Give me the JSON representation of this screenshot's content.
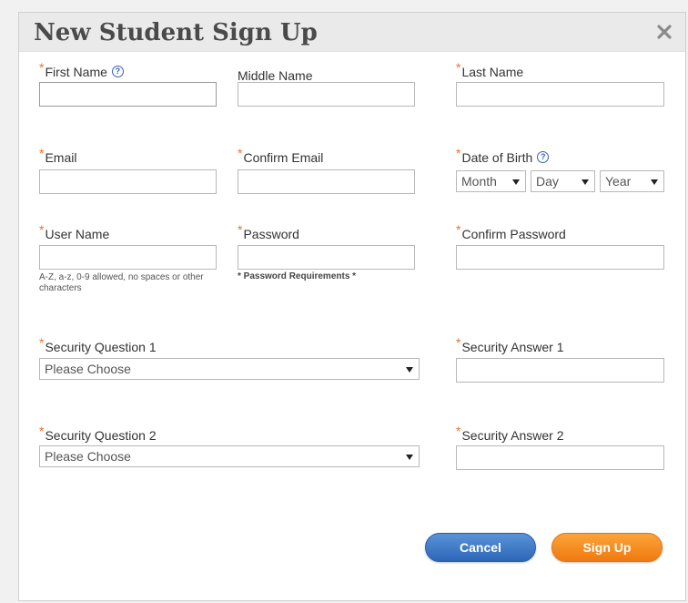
{
  "dialog": {
    "title": "New Student Sign Up",
    "close_icon": "close-icon"
  },
  "fields": {
    "first_name": {
      "label": "First Name",
      "required": true,
      "has_help": true,
      "value": ""
    },
    "middle_name": {
      "label": "Middle Name",
      "required": false,
      "value": ""
    },
    "last_name": {
      "label": "Last Name",
      "required": true,
      "value": ""
    },
    "email": {
      "label": "Email",
      "required": true,
      "value": ""
    },
    "confirm_email": {
      "label": "Confirm Email",
      "required": true,
      "value": ""
    },
    "date_of_birth": {
      "label": "Date of Birth",
      "required": true,
      "has_help": true,
      "month": "Month",
      "day": "Day",
      "year": "Year"
    },
    "user_name": {
      "label": "User Name",
      "required": true,
      "value": "",
      "hint": "A-Z, a-z, 0-9 allowed, no spaces or other characters"
    },
    "password": {
      "label": "Password",
      "required": true,
      "value": "",
      "requirements_link": "* Password Requirements *"
    },
    "confirm_password": {
      "label": "Confirm Password",
      "required": true,
      "value": ""
    },
    "security_question_1": {
      "label": "Security Question 1",
      "required": true,
      "selected": "Please Choose"
    },
    "security_answer_1": {
      "label": "Security Answer 1",
      "required": true,
      "value": ""
    },
    "security_question_2": {
      "label": "Security Question 2",
      "required": true,
      "selected": "Please Choose"
    },
    "security_answer_2": {
      "label": "Security Answer 2",
      "required": true,
      "value": ""
    }
  },
  "required_marker": "*",
  "help_icon_glyph": "?",
  "buttons": {
    "cancel": "Cancel",
    "sign_up": "Sign Up"
  },
  "colors": {
    "required_asterisk": "#e9732a",
    "help_icon": "#3b5fc0",
    "cancel_button": "#3a76c6",
    "signup_button": "#f58a1f"
  }
}
